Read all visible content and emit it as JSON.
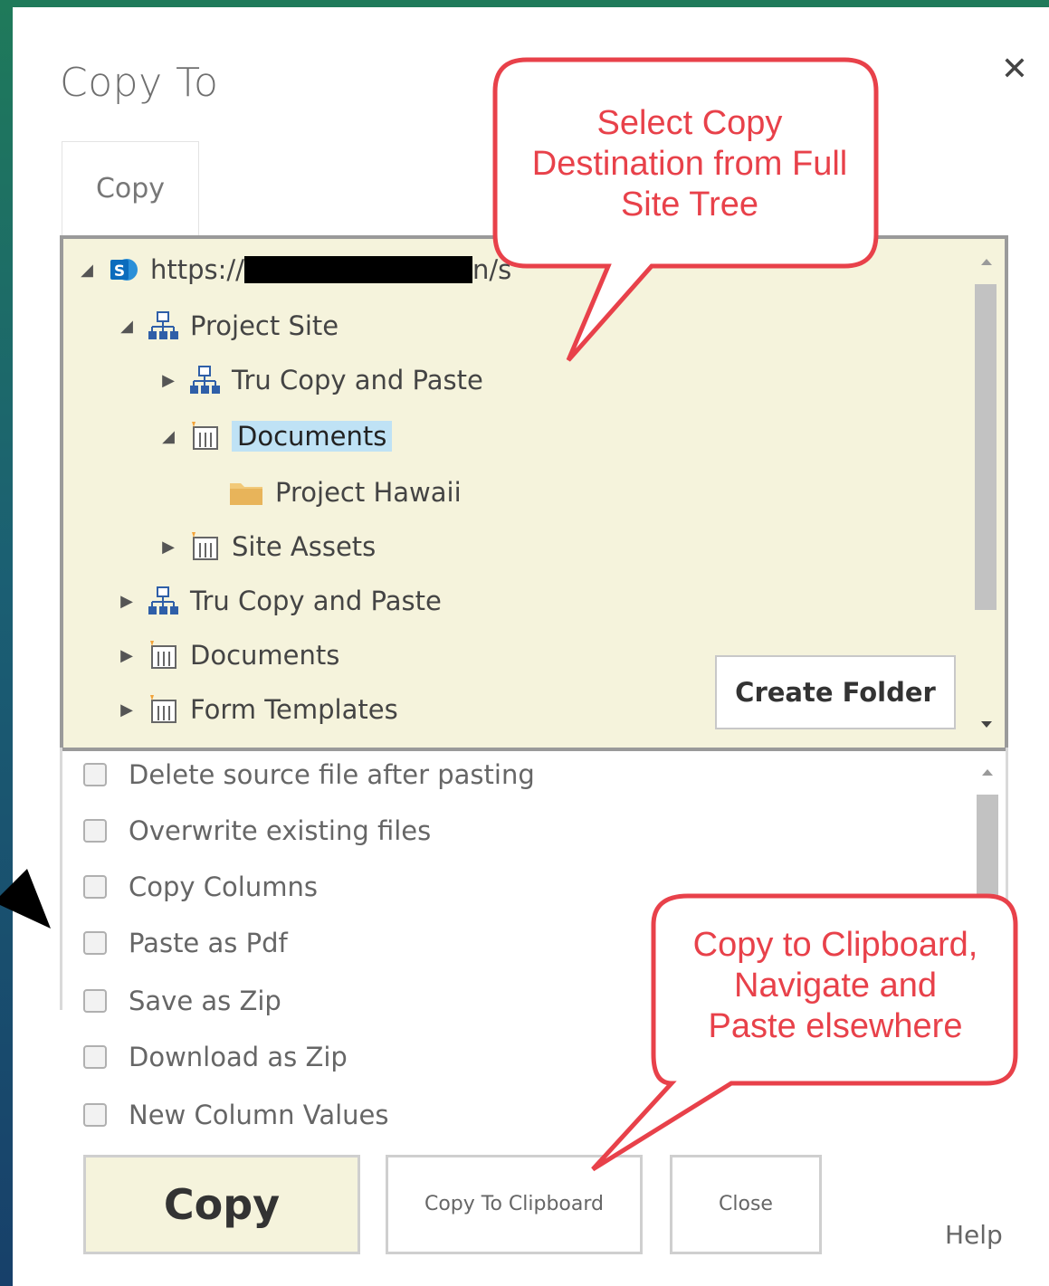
{
  "dialog": {
    "title": "Copy To",
    "close_icon": "close-icon"
  },
  "tabs": [
    {
      "label": "Copy",
      "active": true
    }
  ],
  "tree": {
    "root_prefix": "https://",
    "root_suffix": "n/s",
    "nodes": [
      {
        "label": "Project Site",
        "icon": "site-icon"
      },
      {
        "label": "Tru Copy and Paste",
        "icon": "site-icon"
      },
      {
        "label": "Documents",
        "icon": "library-icon",
        "selected": true
      },
      {
        "label": "Project Hawaii",
        "icon": "folder-icon"
      },
      {
        "label": "Site Assets",
        "icon": "library-icon"
      },
      {
        "label": "Tru Copy and Paste",
        "icon": "site-icon"
      },
      {
        "label": "Documents",
        "icon": "library-icon"
      },
      {
        "label": "Form Templates",
        "icon": "library-icon"
      }
    ],
    "create_folder_label": "Create Folder"
  },
  "options": [
    {
      "label": "Delete source file after pasting",
      "checked": false
    },
    {
      "label": "Overwrite existing files",
      "checked": false
    },
    {
      "label": "Copy Columns",
      "checked": false
    },
    {
      "label": "Paste as Pdf",
      "checked": false
    },
    {
      "label": "Save as Zip",
      "checked": false
    },
    {
      "label": "Download as Zip",
      "checked": false
    },
    {
      "label": "New Column Values",
      "checked": false
    }
  ],
  "buttons": {
    "copy": "Copy",
    "copy_to_clipboard": "Copy To Clipboard",
    "close": "Close",
    "help": "Help"
  },
  "callouts": {
    "tree": [
      "Select Copy",
      "Destination from Full",
      "Site Tree"
    ],
    "clipboard": [
      "Copy to Clipboard,",
      "Navigate and",
      "Paste elsewhere"
    ]
  },
  "colors": {
    "tree_bg": "#f5f3dc",
    "selection": "#bfe2f5",
    "callout_border": "#e8414a",
    "callout_text": "#e8414a"
  }
}
